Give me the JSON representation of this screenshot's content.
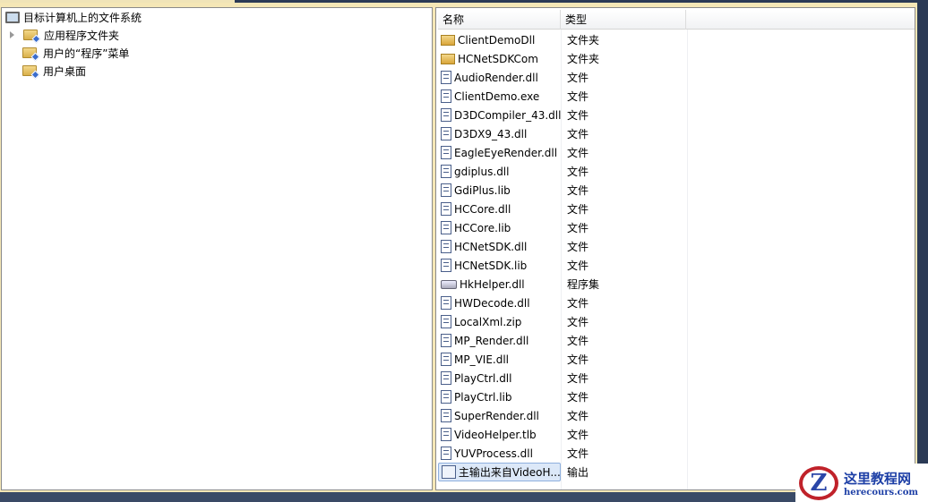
{
  "tree": {
    "root": "目标计算机上的文件系统",
    "items": [
      "应用程序文件夹",
      "用户的“程序”菜单",
      "用户桌面"
    ]
  },
  "list": {
    "columns": [
      "名称",
      "类型"
    ],
    "rows": [
      {
        "name": "ClientDemoDll",
        "type": "文件夹",
        "icon": "folder"
      },
      {
        "name": "HCNetSDKCom",
        "type": "文件夹",
        "icon": "folder"
      },
      {
        "name": "AudioRender.dll",
        "type": "文件",
        "icon": "file"
      },
      {
        "name": "ClientDemo.exe",
        "type": "文件",
        "icon": "file"
      },
      {
        "name": "D3DCompiler_43.dll",
        "type": "文件",
        "icon": "file"
      },
      {
        "name": "D3DX9_43.dll",
        "type": "文件",
        "icon": "file"
      },
      {
        "name": "EagleEyeRender.dll",
        "type": "文件",
        "icon": "file"
      },
      {
        "name": "gdiplus.dll",
        "type": "文件",
        "icon": "file"
      },
      {
        "name": "GdiPlus.lib",
        "type": "文件",
        "icon": "file"
      },
      {
        "name": "HCCore.dll",
        "type": "文件",
        "icon": "file"
      },
      {
        "name": "HCCore.lib",
        "type": "文件",
        "icon": "file"
      },
      {
        "name": "HCNetSDK.dll",
        "type": "文件",
        "icon": "file"
      },
      {
        "name": "HCNetSDK.lib",
        "type": "文件",
        "icon": "file"
      },
      {
        "name": "HkHelper.dll",
        "type": "程序集",
        "icon": "assembly"
      },
      {
        "name": "HWDecode.dll",
        "type": "文件",
        "icon": "file"
      },
      {
        "name": "LocalXml.zip",
        "type": "文件",
        "icon": "file"
      },
      {
        "name": "MP_Render.dll",
        "type": "文件",
        "icon": "file"
      },
      {
        "name": "MP_VIE.dll",
        "type": "文件",
        "icon": "file"
      },
      {
        "name": "PlayCtrl.dll",
        "type": "文件",
        "icon": "file"
      },
      {
        "name": "PlayCtrl.lib",
        "type": "文件",
        "icon": "file"
      },
      {
        "name": "SuperRender.dll",
        "type": "文件",
        "icon": "file"
      },
      {
        "name": "VideoHelper.tlb",
        "type": "文件",
        "icon": "file"
      },
      {
        "name": "YUVProcess.dll",
        "type": "文件",
        "icon": "file"
      },
      {
        "name": "主输出来自VideoH...",
        "type": "输出",
        "icon": "output",
        "selected": true
      }
    ]
  },
  "watermark": {
    "title": "这里教程网",
    "url": "herecours.com",
    "logo_letter": "Z"
  }
}
